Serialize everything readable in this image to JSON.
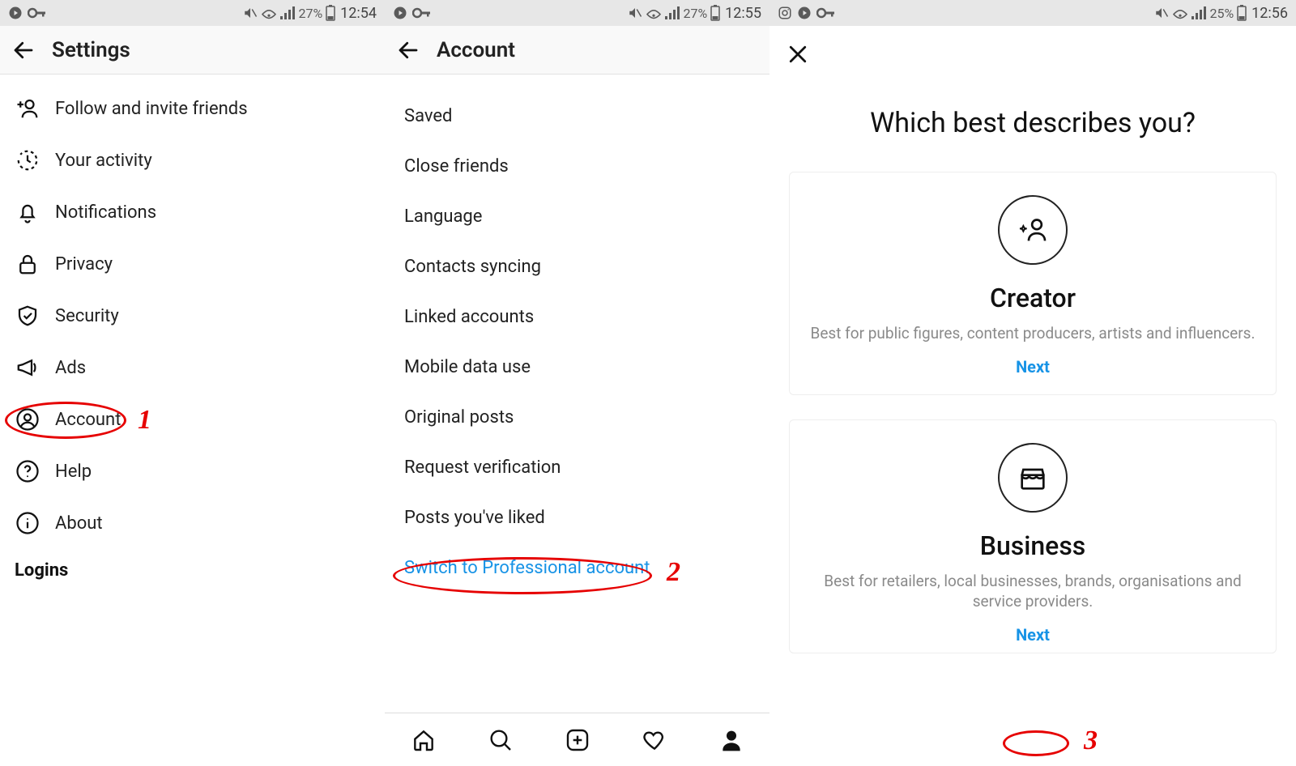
{
  "screens": {
    "settings": {
      "status": {
        "battery_pct": "27%",
        "time": "12:54"
      },
      "title": "Settings",
      "items": [
        {
          "key": "follow-invite",
          "label": "Follow and invite friends"
        },
        {
          "key": "your-activity",
          "label": "Your activity"
        },
        {
          "key": "notifications",
          "label": "Notifications"
        },
        {
          "key": "privacy",
          "label": "Privacy"
        },
        {
          "key": "security",
          "label": "Security"
        },
        {
          "key": "ads",
          "label": "Ads"
        },
        {
          "key": "account",
          "label": "Account"
        },
        {
          "key": "help",
          "label": "Help"
        },
        {
          "key": "about",
          "label": "About"
        }
      ],
      "section_logins": "Logins",
      "annotation_number": "1"
    },
    "account": {
      "status": {
        "battery_pct": "27%",
        "time": "12:55"
      },
      "title": "Account",
      "items": [
        {
          "key": "saved",
          "label": "Saved"
        },
        {
          "key": "close-friends",
          "label": "Close friends"
        },
        {
          "key": "language",
          "label": "Language"
        },
        {
          "key": "contacts-syncing",
          "label": "Contacts syncing"
        },
        {
          "key": "linked-accounts",
          "label": "Linked accounts"
        },
        {
          "key": "mobile-data-use",
          "label": "Mobile data use"
        },
        {
          "key": "original-posts",
          "label": "Original posts"
        },
        {
          "key": "request-verification",
          "label": "Request verification"
        },
        {
          "key": "posts-liked",
          "label": "Posts you've liked"
        }
      ],
      "switch_pro_label": "Switch to Professional account",
      "annotation_number": "2"
    },
    "describe": {
      "status": {
        "battery_pct": "25%",
        "time": "12:56"
      },
      "heading": "Which best describes you?",
      "creator": {
        "title": "Creator",
        "desc": "Best for public figures, content producers, artists and influencers.",
        "next": "Next"
      },
      "business": {
        "title": "Business",
        "desc": "Best for retailers, local businesses, brands, organisations and service providers.",
        "next": "Next"
      },
      "annotation_number": "3"
    }
  }
}
